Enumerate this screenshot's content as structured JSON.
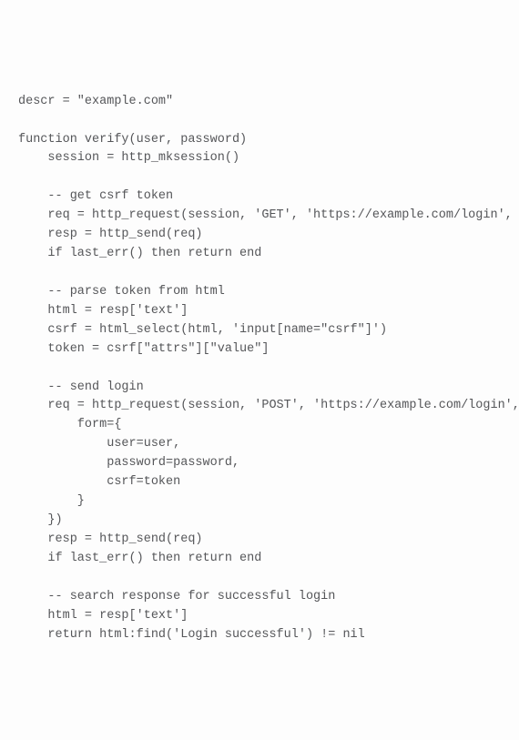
{
  "code": {
    "l01": "descr = \"example.com\"",
    "l02": "",
    "l03": "function verify(user, password)",
    "l04": "    session = http_mksession()",
    "l05": "",
    "l06": "    -- get csrf token",
    "l07": "    req = http_request(session, 'GET', 'https://example.com/login', ",
    "l08": "    resp = http_send(req)",
    "l09": "    if last_err() then return end",
    "l10": "",
    "l11": "    -- parse token from html",
    "l12": "    html = resp['text']",
    "l13": "    csrf = html_select(html, 'input[name=\"csrf\"]')",
    "l14": "    token = csrf[\"attrs\"][\"value\"]",
    "l15": "",
    "l16": "    -- send login",
    "l17": "    req = http_request(session, 'POST', 'https://example.com/login',",
    "l18": "        form={",
    "l19": "            user=user,",
    "l20": "            password=password,",
    "l21": "            csrf=token",
    "l22": "        }",
    "l23": "    })",
    "l24": "    resp = http_send(req)",
    "l25": "    if last_err() then return end",
    "l26": "",
    "l27": "    -- search response for successful login",
    "l28": "    html = resp['text']",
    "l29": "    return html:find('Login successful') != nil"
  }
}
